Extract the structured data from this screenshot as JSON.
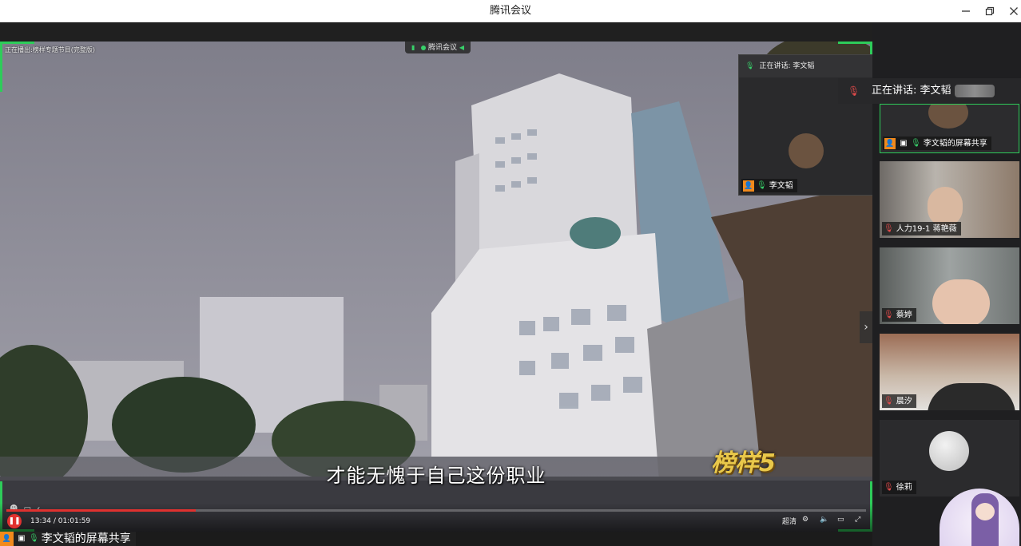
{
  "window": {
    "title": "腾讯会议"
  },
  "share": {
    "playing_label": "正在播出:榜样专题节目(完整版)",
    "brand": "腾讯会议",
    "subtitle": "才能无愧于自己这份职业",
    "show_logo": "榜样5",
    "bottom_tag": "李文韬的屏幕共享"
  },
  "player": {
    "current": "13:34",
    "separator": "/",
    "total": "01:01:59",
    "progress": 0.22,
    "quality": "超清"
  },
  "pip": {
    "speaking": "正在讲话: 李文韬",
    "name": "李文韬"
  },
  "speaking_banner": "正在讲话: 李文韬",
  "participants": [
    {
      "name": "李文韬的屏幕共享",
      "active": true
    },
    {
      "name": "人力19-1 蒋艳薇"
    },
    {
      "name": "蔡婷"
    },
    {
      "name": "晨汐"
    },
    {
      "name": "徐莉"
    }
  ],
  "colors": {
    "accent": "#2ecc5a",
    "progress": "#e0312f",
    "user_icon": "#f28a1c"
  }
}
